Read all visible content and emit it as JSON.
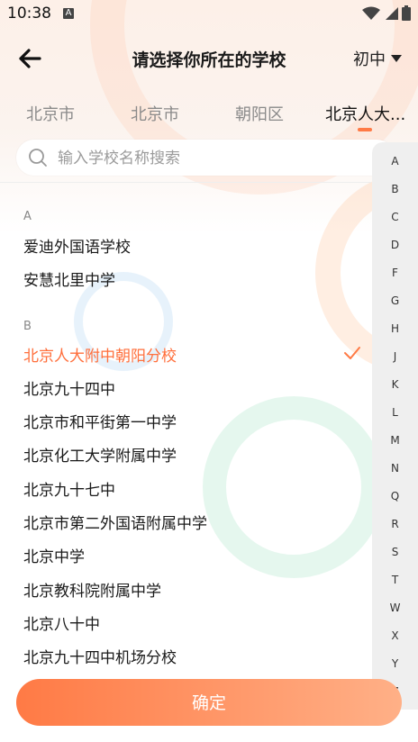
{
  "status_bar": {
    "time": "10:38",
    "notif": "A"
  },
  "header": {
    "title": "请选择你所在的学校",
    "grade": "初中"
  },
  "tabs": [
    "北京市",
    "北京市",
    "朝阳区",
    "北京人大..."
  ],
  "search": {
    "placeholder": "输入学校名称搜索",
    "value": ""
  },
  "sections": [
    {
      "letter": "A",
      "schools": [
        "爱迪外国语学校",
        "安慧北里中学"
      ]
    },
    {
      "letter": "B",
      "schools": [
        "北京人大附中朝阳分校",
        "北京九十四中",
        "北京市和平街第一中学",
        "北京化工大学附属中学",
        "北京九十七中",
        "北京市第二外国语附属中学",
        "北京中学",
        "北京教科院附属中学",
        "北京八十中",
        "北京九十四中机场分校"
      ]
    }
  ],
  "selected_school": "北京人大附中朝阳分校",
  "index_letters": [
    "A",
    "B",
    "C",
    "D",
    "F",
    "G",
    "H",
    "J",
    "K",
    "L",
    "M",
    "N",
    "Q",
    "R",
    "S",
    "T",
    "W",
    "X",
    "Y",
    "Z"
  ],
  "confirm_label": "确定",
  "colors": {
    "accent": "#ff7a45",
    "selected_text": "#ff6f3c",
    "gradient_end": "#ffb087"
  },
  "icons": {
    "back": "arrow-left-icon",
    "dropdown": "caret-down-icon",
    "search": "search-icon",
    "check": "check-icon"
  }
}
